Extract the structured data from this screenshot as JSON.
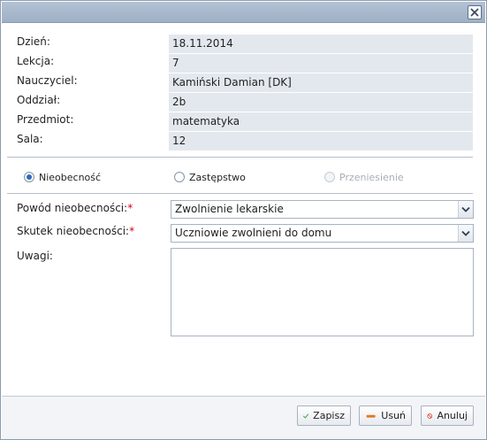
{
  "dialog": {
    "close_icon": "close-icon"
  },
  "info": {
    "day_label": "Dzień:",
    "day_value": "18.11.2014",
    "lesson_label": "Lekcja:",
    "lesson_value": "7",
    "teacher_label": "Nauczyciel:",
    "teacher_value": "Kamiński Damian [DK]",
    "class_label": "Oddział:",
    "class_value": "2b",
    "subject_label": "Przedmiot:",
    "subject_value": "matematyka",
    "room_label": "Sala:",
    "room_value": "12"
  },
  "mode": {
    "absence_label": "Nieobecność",
    "substitution_label": "Zastępstwo",
    "transfer_label": "Przeniesienie",
    "selected": "absence"
  },
  "form": {
    "reason_label": "Powód nieobecności:",
    "reason_value": "Zwolnienie lekarskie",
    "effect_label": "Skutek nieobecności:",
    "effect_value": "Uczniowie zwolnieni do domu",
    "required_mark": "*",
    "notes_label": "Uwagi:",
    "notes_value": ""
  },
  "buttons": {
    "save_label": "Zapisz",
    "delete_label": "Usuń",
    "cancel_label": "Anuluj"
  },
  "colors": {
    "titlebar": "#a9bace",
    "info_bg": "#e3e8ee",
    "radio_dot": "#2c6bb8",
    "required": "#d0021b",
    "save_icon": "#3aa33a",
    "delete_icon": "#e07a1f",
    "cancel_icon": "#d63a2a"
  }
}
